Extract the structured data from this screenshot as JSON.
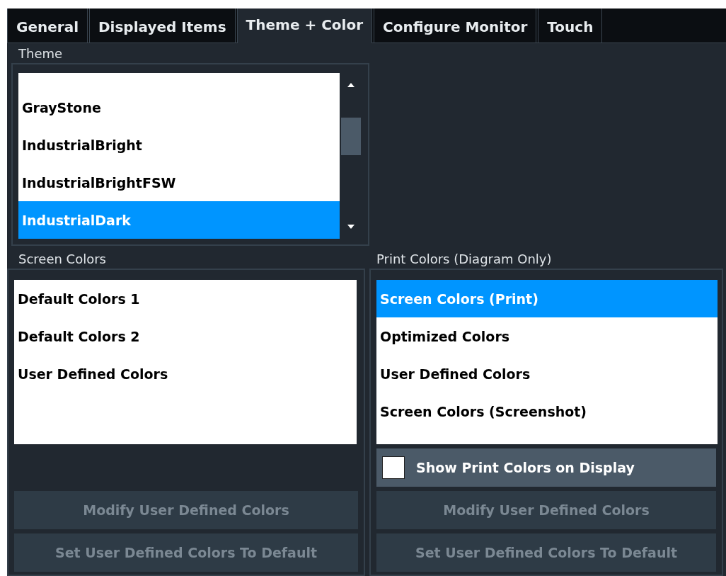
{
  "tabs": [
    {
      "label": "General",
      "selected": false
    },
    {
      "label": "Displayed Items",
      "selected": false
    },
    {
      "label": "Theme + Color",
      "selected": true
    },
    {
      "label": "Configure Monitor",
      "selected": false
    },
    {
      "label": "Touch",
      "selected": false
    }
  ],
  "theme": {
    "label": "Theme",
    "items": [
      {
        "label": "GrayStone",
        "selected": false
      },
      {
        "label": "IndustrialBright",
        "selected": false
      },
      {
        "label": "IndustrialBrightFSW",
        "selected": false
      },
      {
        "label": "IndustrialDark",
        "selected": true
      }
    ]
  },
  "screen_colors": {
    "label": "Screen Colors",
    "items": [
      {
        "label": "Default Colors 1",
        "selected": false
      },
      {
        "label": "Default Colors 2",
        "selected": false
      },
      {
        "label": "User Defined Colors",
        "selected": false
      }
    ],
    "buttons": [
      {
        "label": "Modify User Defined Colors",
        "disabled": true
      },
      {
        "label": "Set User Defined Colors To Default",
        "disabled": true
      }
    ]
  },
  "print_colors": {
    "label": "Print Colors (Diagram Only)",
    "items": [
      {
        "label": "Screen Colors (Print)",
        "selected": true
      },
      {
        "label": "Optimized Colors",
        "selected": false
      },
      {
        "label": "User Defined Colors",
        "selected": false
      },
      {
        "label": "Screen Colors (Screenshot)",
        "selected": false
      }
    ],
    "show_on_display": {
      "label": "Show Print Colors on Display",
      "checked": false
    },
    "buttons": [
      {
        "label": "Modify User Defined Colors",
        "disabled": true
      },
      {
        "label": "Set User Defined Colors To Default",
        "disabled": true
      }
    ]
  }
}
